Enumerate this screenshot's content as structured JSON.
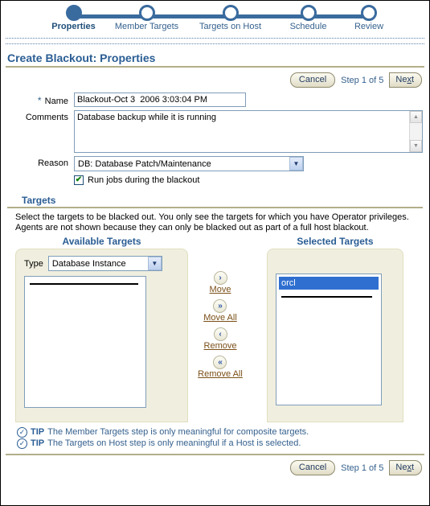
{
  "train": {
    "steps": [
      {
        "label": "Properties",
        "active": true
      },
      {
        "label": "Member Targets",
        "active": false
      },
      {
        "label": "Targets on Host",
        "active": false
      },
      {
        "label": "Schedule",
        "active": false
      },
      {
        "label": "Review",
        "active": false
      }
    ]
  },
  "header": {
    "title": "Create Blackout: Properties"
  },
  "toolbar": {
    "cancel_label": "Cancel",
    "step_text": "Step 1 of 5",
    "next_label": "Next",
    "next_accesskey": "x"
  },
  "form": {
    "name_label": "Name",
    "name_required_mark": "*",
    "name_value": "Blackout-Oct 3  2006 3:03:04 PM",
    "comments_label": "Comments",
    "comments_value": "Database backup while it is running",
    "reason_label": "Reason",
    "reason_value": "DB: Database Patch/Maintenance",
    "run_jobs_label": "Run jobs during the blackout",
    "run_jobs_checked": true,
    "checkmark": "✔"
  },
  "targets": {
    "section_title": "Targets",
    "description": "Select the targets to be blacked out. You only see the targets for which you have Operator privileges. Agents are not shown because they can only be blacked out as part of a full host blackout.",
    "available_header": "Available Targets",
    "selected_header": "Selected Targets",
    "type_label": "Type",
    "type_value": "Database Instance",
    "available_items": [],
    "selected_items": [
      {
        "label": "orcl",
        "selected": true
      }
    ],
    "move_buttons": [
      {
        "label": "Move",
        "glyph": "›",
        "icon": "chevron-right-icon"
      },
      {
        "label": "Move All",
        "glyph": "»",
        "icon": "chevron-double-right-icon"
      },
      {
        "label": "Remove",
        "glyph": "‹",
        "icon": "chevron-left-icon"
      },
      {
        "label": "Remove All",
        "glyph": "«",
        "icon": "chevron-double-left-icon"
      }
    ]
  },
  "tips": {
    "keyword": "TIP",
    "icon": "✓",
    "items": [
      "The Member Targets step is only meaningful for composite targets.",
      "The Targets on Host step is only meaningful if a Host is selected."
    ]
  },
  "footer": {
    "cancel_label": "Cancel",
    "step_text": "Step 1 of 5",
    "next_label": "Next"
  },
  "colors": {
    "train_blue": "#3a6b9e",
    "heading_blue": "#2a5d94",
    "rule_tan": "#b3ae8a",
    "panel_cream": "#f0efdf",
    "selection_blue": "#2f6fd0",
    "link_brown": "#7a4f17",
    "check_green": "#108010"
  },
  "scroll": {
    "up_glyph": "▲",
    "down_glyph": "▼"
  },
  "select_arrow_glyph": "▼"
}
